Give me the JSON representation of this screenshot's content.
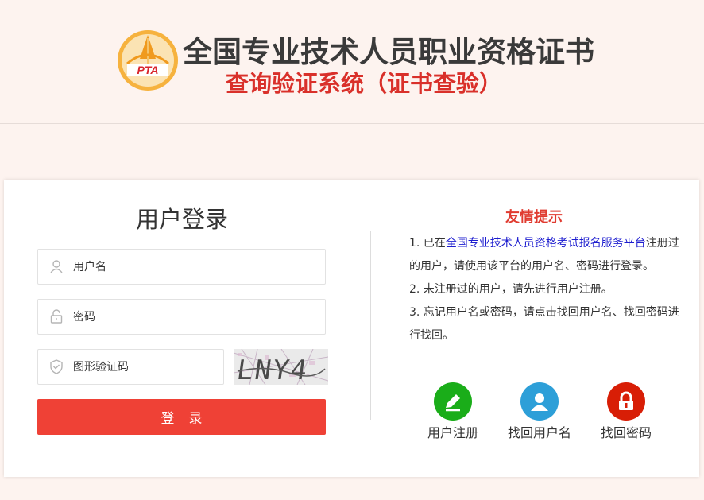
{
  "header": {
    "logo_text": "PTA",
    "title_main": "全国专业技术人员职业资格证书",
    "title_sub": "查询验证系统（证书查验）"
  },
  "login": {
    "title": "用户登录",
    "username_placeholder": "用户名",
    "password_placeholder": "密码",
    "captcha_placeholder": "图形验证码",
    "captcha_text": "LNY4",
    "submit_label": "登录"
  },
  "tips": {
    "title": "友情提示",
    "item1_prefix": "1. 已在",
    "item1_link": "全国专业技术人员资格考试报名服务平台",
    "item1_suffix": "注册过的用户，请使用该平台的用户名、密码进行登录。",
    "item2": "2. 未注册过的用户，请先进行用户注册。",
    "item3": "3. 忘记用户名或密码，请点击找回用户名、找回密码进行找回。"
  },
  "actions": [
    {
      "label": "用户注册",
      "icon": "pencil-icon",
      "color": "#1aad19"
    },
    {
      "label": "找回用户名",
      "icon": "user-icon",
      "color": "#2d9fd8"
    },
    {
      "label": "找回密码",
      "icon": "lock-icon",
      "color": "#d81e06"
    }
  ],
  "colors": {
    "accent_red": "#ef4136",
    "tips_title": "#e03b30",
    "link_blue": "#1d1dcf",
    "background": "#fdf3ef"
  }
}
